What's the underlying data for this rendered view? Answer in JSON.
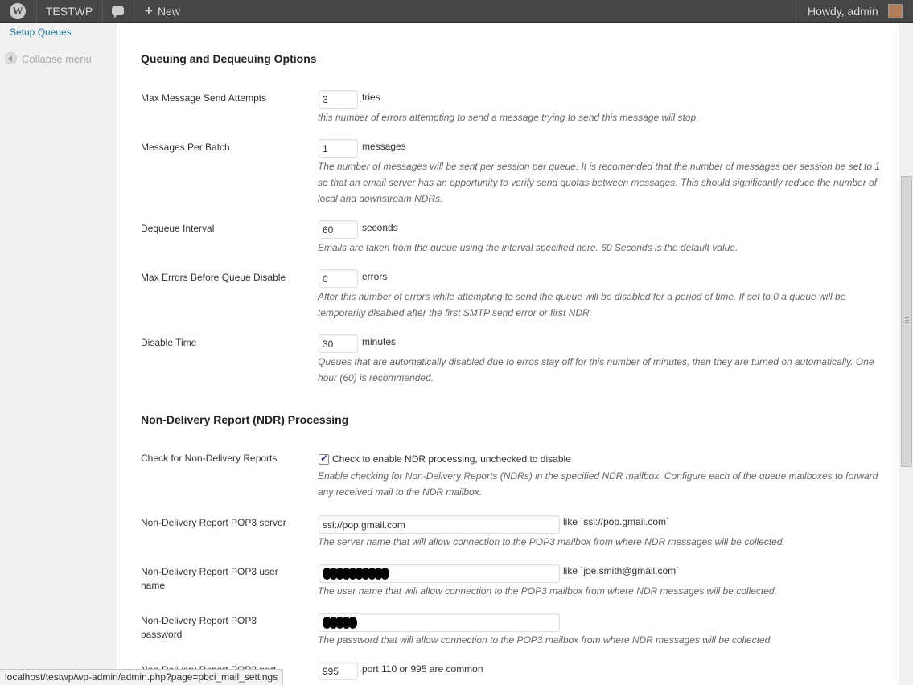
{
  "adminbar": {
    "wp_logo": "W",
    "site_name": "TESTWP",
    "new_label": "New",
    "howdy": "Howdy, admin"
  },
  "sidebar": {
    "setup_queues": "Setup Queues",
    "collapse": "Collapse menu"
  },
  "sections": {
    "queuing_title": "Queuing and Dequeuing Options",
    "ndr_title": "Non-Delivery Report (NDR) Processing"
  },
  "fields": {
    "max_attempts": {
      "label": "Max Message Send Attempts",
      "value": "3",
      "unit": "tries",
      "desc": "this number of errors attempting to send a message trying to send this message will stop."
    },
    "per_batch": {
      "label": "Messages Per Batch",
      "value": "1",
      "unit": "messages",
      "desc": "The number of messages will be sent per session per queue. It is recomended that the number of messages per session be set to 1 so that an email server has an opportunity to verify send quotas between messages. This should significantly reduce the number of local and downstream NDRs."
    },
    "dequeue_interval": {
      "label": "Dequeue Interval",
      "value": "60",
      "unit": "seconds",
      "desc": "Emails are taken from the queue using the interval specified here. 60 Seconds is the default value."
    },
    "max_errors": {
      "label": "Max Errors Before Queue Disable",
      "value": "0",
      "unit": "errors",
      "desc": "After this number of errors while attempting to send the queue will be disabled for a period of time. If set to 0 a queue will be temporarily disabled after the first SMTP send error or first NDR."
    },
    "disable_time": {
      "label": "Disable Time",
      "value": "30",
      "unit": "minutes",
      "desc": "Queues that are automatically disabled due to erros stay off for this number of minutes, then they are turned on automatically. One hour (60) is recommended."
    },
    "check_ndr": {
      "label": "Check for Non-Delivery Reports",
      "checkbox_label": "Check to enable NDR processing, unchecked to disable",
      "desc": "Enable checking for Non-Delivery Reports (NDRs) in the specified NDR mailbox. Configure each of the queue mailboxes to forward any received mail to the NDR mailbox."
    },
    "pop3_server": {
      "label": "Non-Delivery Report POP3 server",
      "value": "ssl://pop.gmail.com",
      "hint": "like `ssl://pop.gmail.com`",
      "desc": "The server name that will allow connection to the POP3 mailbox from where NDR messages will be collected."
    },
    "pop3_user": {
      "label": "Non-Delivery Report POP3 user name",
      "hint": "like `joe.smith@gmail.com`",
      "desc": "The user name that will allow connection to the POP3 mailbox from where NDR messages will be collected."
    },
    "pop3_password": {
      "label": "Non-Delivery Report POP3 password",
      "desc": "The password that will allow connection to the POP3 mailbox from where NDR messages will be collected."
    },
    "pop3_port": {
      "label": "Non-Delivery Report POP3 port",
      "value": "995",
      "hint": "port 110 or 995 are common"
    }
  },
  "statusbar": {
    "url": "localhost/testwp/wp-admin/admin.php?page=pbci_mail_settings"
  },
  "icons": {
    "wordpress": "wordpress-logo-icon",
    "comments": "comment-bubble-icon",
    "new": "plus-icon",
    "collapse": "collapse-arrow-icon",
    "avatar": "avatar"
  },
  "colors": {
    "adminbar": "#464646",
    "link": "#21759b",
    "sidebar": "#f1f1f1"
  }
}
